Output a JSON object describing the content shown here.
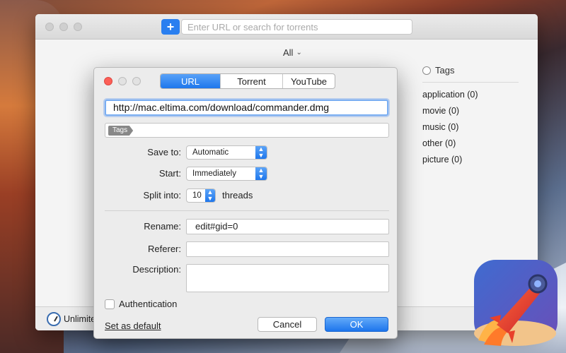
{
  "toolbar": {
    "add_button": "+",
    "search_placeholder": "Enter URL or search for torrents"
  },
  "filter": {
    "label": "All"
  },
  "tags_panel": {
    "title": "Tags",
    "items": [
      "application (0)",
      "movie (0)",
      "music (0)",
      "other (0)",
      "picture (0)"
    ]
  },
  "status": {
    "speed_label": "Unlimite"
  },
  "dialog": {
    "tabs": [
      "URL",
      "Torrent",
      "YouTube"
    ],
    "active_tab": "URL",
    "url_value": "http://mac.eltima.com/download/commander.dmg",
    "tags_chip": "Tags",
    "save_to_label": "Save to:",
    "save_to_value": "Automatic",
    "start_label": "Start:",
    "start_value": "Immediately",
    "split_label": "Split into:",
    "split_value": "10",
    "threads_label": "threads",
    "rename_label": "Rename:",
    "rename_value": "edit#gid=0",
    "referer_label": "Referer:",
    "referer_value": "",
    "description_label": "Description:",
    "description_value": "",
    "auth_label": "Authentication",
    "set_default": "Set as default",
    "cancel": "Cancel",
    "ok": "OK"
  },
  "colors": {
    "accent": "#1e76ec",
    "close": "#fc5f57"
  }
}
